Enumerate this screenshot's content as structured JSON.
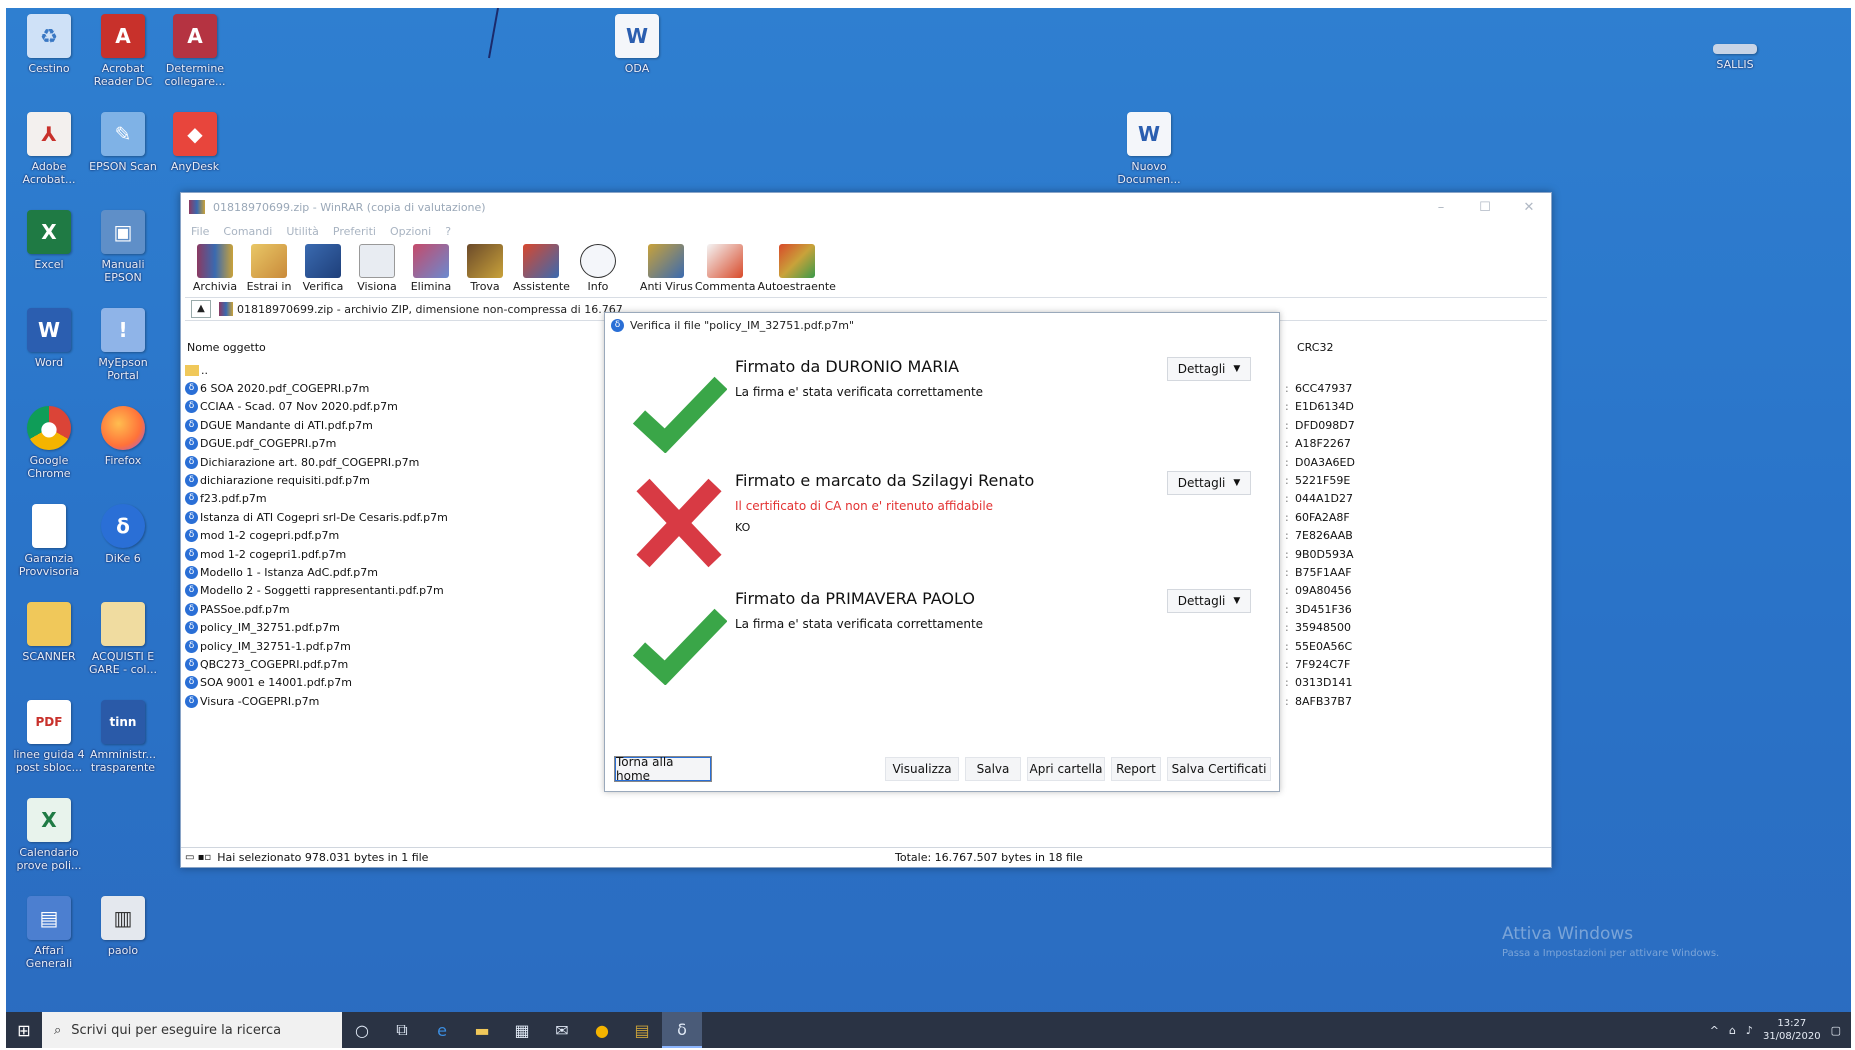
{
  "desktop": {
    "icons": [
      {
        "label": "Cestino",
        "icon": "recycle-bin-icon"
      },
      {
        "label": "Acrobat Reader DC",
        "icon": "acrobat-icon"
      },
      {
        "label": "Determine collegare...",
        "icon": "access-db-icon"
      },
      {
        "label": "ODA",
        "icon": "word-doc-icon"
      },
      {
        "label": "SALLIS",
        "icon": "sallis-icon"
      },
      {
        "label": "Adobe Acrobat...",
        "icon": "adobe-acrobat-icon"
      },
      {
        "label": "EPSON Scan",
        "icon": "epson-scan-icon"
      },
      {
        "label": "AnyDesk",
        "icon": "anydesk-icon"
      },
      {
        "label": "Nuovo Documen...",
        "icon": "word-doc-icon"
      },
      {
        "label": "Excel",
        "icon": "excel-icon"
      },
      {
        "label": "Manuali EPSON",
        "icon": "epson-manual-icon"
      },
      {
        "label": "Word",
        "icon": "word-icon"
      },
      {
        "label": "MyEpson Portal",
        "icon": "myepson-icon"
      },
      {
        "label": "Google Chrome",
        "icon": "chrome-icon"
      },
      {
        "label": "Firefox",
        "icon": "firefox-icon"
      },
      {
        "label": "Garanzia Provvisoria",
        "icon": "document-icon"
      },
      {
        "label": "DiKe 6",
        "icon": "dike-icon"
      },
      {
        "label": "SCANNER",
        "icon": "folder-icon"
      },
      {
        "label": "ACQUISTI E GARE - col...",
        "icon": "folder-icon"
      },
      {
        "label": "linee guida 4 post sbloc...",
        "icon": "pdf-icon"
      },
      {
        "label": "Amministr... trasparente",
        "icon": "tinn-icon"
      },
      {
        "label": "Calendario prove poli...",
        "icon": "excel-file-icon"
      },
      {
        "label": "Affari Generali",
        "icon": "affari-icon"
      },
      {
        "label": "paolo",
        "icon": "paolo-icon"
      }
    ]
  },
  "winrar": {
    "title": "01818970699.zip - WinRAR (copia di valutazione)",
    "menu": [
      "File",
      "Comandi",
      "Utilità",
      "Preferiti",
      "Opzioni",
      "?"
    ],
    "toolbar": [
      "Archivia",
      "Estrai in",
      "Verifica",
      "Visiona",
      "Elimina",
      "Trova",
      "Assistente",
      "Info",
      "Anti Virus",
      "Commenta",
      "Autoestraente"
    ],
    "address": "01818970699.zip - archivio ZIP, dimensione non-compressa di 16.767",
    "list_header": "Nome oggetto",
    "crc_header": "CRC32",
    "files": [
      {
        "name": "6 SOA 2020.pdf_COGEPRI.p7m",
        "crc": "6CC47937"
      },
      {
        "name": "CCIAA - Scad. 07 Nov 2020.pdf.p7m",
        "crc": "E1D6134D"
      },
      {
        "name": "DGUE Mandante di ATI.pdf.p7m",
        "crc": "DFD098D7"
      },
      {
        "name": "DGUE.pdf_COGEPRI.p7m",
        "crc": "A18F2267"
      },
      {
        "name": "Dichiarazione art. 80.pdf_COGEPRI.p7m",
        "crc": "D0A3A6ED"
      },
      {
        "name": "dichiarazione requisiti.pdf.p7m",
        "crc": "5221F59E"
      },
      {
        "name": "f23.pdf.p7m",
        "crc": "044A1D27"
      },
      {
        "name": "Istanza di ATI Cogepri srl-De Cesaris.pdf.p7m",
        "crc": "60FA2A8F"
      },
      {
        "name": "mod 1-2 cogepri.pdf.p7m",
        "crc": "7E826AAB"
      },
      {
        "name": "mod 1-2 cogepri1.pdf.p7m",
        "crc": "9B0D593A"
      },
      {
        "name": "Modello 1 - Istanza AdC.pdf.p7m",
        "crc": "B75F1AAF"
      },
      {
        "name": "Modello 2 - Soggetti rappresentanti.pdf.p7m",
        "crc": "09A80456"
      },
      {
        "name": "PASSoe.pdf.p7m",
        "crc": "3D451F36"
      },
      {
        "name": "policy_IM_32751.pdf.p7m",
        "crc": "35948500"
      },
      {
        "name": "policy_IM_32751-1.pdf.p7m",
        "crc": "55E0A56C"
      },
      {
        "name": "QBC273_COGEPRI.pdf.p7m",
        "crc": "7F924C7F"
      },
      {
        "name": "SOA 9001 e 14001.pdf.p7m",
        "crc": "0313D141"
      },
      {
        "name": "Visura -COGEPRI.p7m",
        "crc": "8AFB37B7"
      }
    ],
    "status_left": "Hai selezionato 978.031 bytes in 1 file",
    "status_right": "Totale: 16.767.507 bytes in 18 file"
  },
  "verify": {
    "title": "Verifica il file \"policy_IM_32751.pdf.p7m\"",
    "signatures": [
      {
        "name": "Firmato da DURONIO MARIA",
        "message": "La firma e' stata verificata correttamente",
        "status": "ok",
        "code": ""
      },
      {
        "name": "Firmato e marcato da Szilagyi Renato",
        "message": "Il certificato di CA non e' ritenuto affidabile",
        "status": "error",
        "code": "KO"
      },
      {
        "name": "Firmato da PRIMAVERA PAOLO",
        "message": "La firma e' stata verificata correttamente",
        "status": "ok",
        "code": ""
      }
    ],
    "details_label": "Dettagli",
    "buttons": {
      "home": "Torna alla home",
      "view": "Visualizza",
      "save": "Salva",
      "open_folder": "Apri cartella",
      "report": "Report",
      "save_certs": "Salva Certificati"
    },
    "colors": {
      "ok": "#3aa648",
      "error": "#d83a44",
      "error_text": "#e33232"
    }
  },
  "taskbar": {
    "search_placeholder": "Scrivi qui per eseguire la ricerca",
    "time": "13:27",
    "date": "31/08/2020"
  },
  "watermark": {
    "line1": "Attiva Windows",
    "line2": "Passa a Impostazioni per attivare Windows."
  }
}
